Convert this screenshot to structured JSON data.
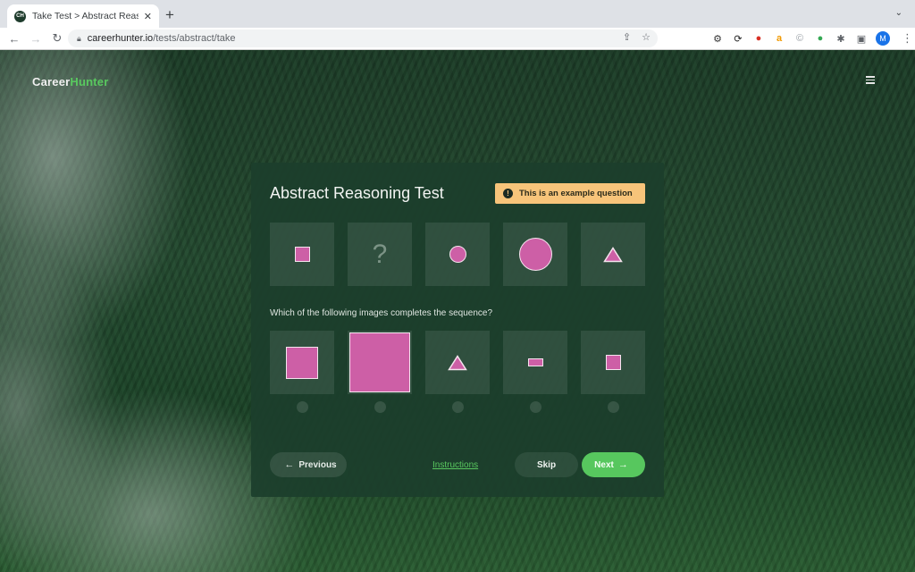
{
  "browser": {
    "tab_title": "Take Test > Abstract Reasoning",
    "favicon_text": "CH",
    "url_host": "careerhunter.io",
    "url_path": "/tests/abstract/take"
  },
  "header": {
    "logo_part1": "Career",
    "logo_part2": "Hunter"
  },
  "card": {
    "title": "Abstract Reasoning Test",
    "badge_text": "This is an example question",
    "badge_icon": "!",
    "sequence": [
      {
        "shape": "small-square"
      },
      {
        "shape": "question-mark",
        "text": "?"
      },
      {
        "shape": "small-circle"
      },
      {
        "shape": "large-circle"
      },
      {
        "shape": "small-triangle"
      }
    ],
    "question": "Which of the following images completes the sequence?",
    "options": [
      {
        "shape": "medium-square",
        "selected": false
      },
      {
        "shape": "large-square",
        "selected": false
      },
      {
        "shape": "small-triangle",
        "selected": false
      },
      {
        "shape": "small-rectangle",
        "selected": false
      },
      {
        "shape": "small-square",
        "selected": false
      }
    ],
    "buttons": {
      "previous": "Previous",
      "instructions": "Instructions",
      "skip": "Skip",
      "next": "Next"
    }
  },
  "colors": {
    "accent_green": "#57c75e",
    "shape_pink": "#cd5fa6",
    "badge_yellow": "#f7c47a"
  }
}
